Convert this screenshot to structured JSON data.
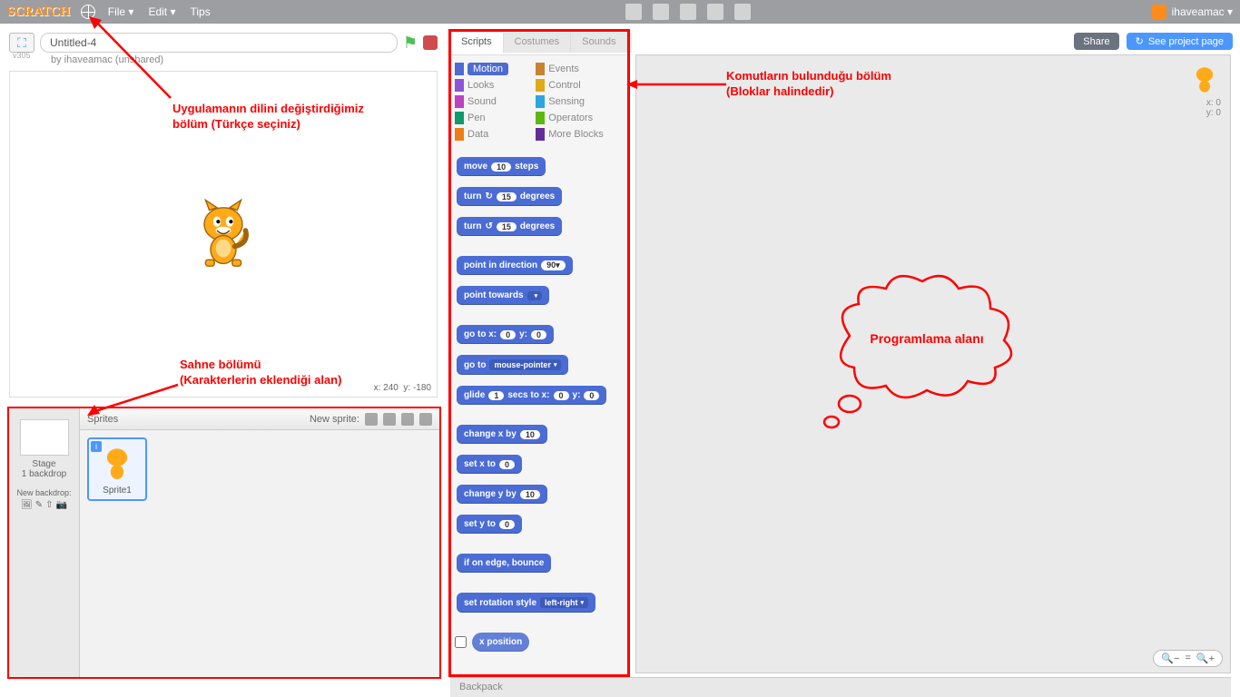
{
  "topbar": {
    "logo": "SCRATCH",
    "menu": {
      "file": "File ▾",
      "edit": "Edit ▾",
      "tips": "Tips"
    },
    "user": "ihaveamac ▾"
  },
  "topbtns": {
    "share": "Share",
    "seepage": "See project page"
  },
  "stagebar": {
    "title": "Untitled-4"
  },
  "byline": "by ihaveamac (unshared)",
  "version": "v305",
  "stage": {
    "xy_x": "x: 240",
    "xy_y": "y: -180"
  },
  "spritepanel": {
    "sprites": "Sprites",
    "newsprite": "New sprite:",
    "stage": "Stage",
    "backdrop": "1 backdrop",
    "newbackdrop": "New backdrop:",
    "sprite1": "Sprite1"
  },
  "tabs": {
    "scripts": "Scripts",
    "costumes": "Costumes",
    "sounds": "Sounds"
  },
  "categories": [
    {
      "name": "Motion",
      "color": "#4a6cd4",
      "active": true
    },
    {
      "name": "Events",
      "color": "#c88330"
    },
    {
      "name": "Looks",
      "color": "#8a55d7"
    },
    {
      "name": "Control",
      "color": "#e1a91a"
    },
    {
      "name": "Sound",
      "color": "#bb42c3"
    },
    {
      "name": "Sensing",
      "color": "#2ca5e2"
    },
    {
      "name": "Pen",
      "color": "#0e9a6c"
    },
    {
      "name": "Operators",
      "color": "#5cb712"
    },
    {
      "name": "Data",
      "color": "#ee7d16"
    },
    {
      "name": "More Blocks",
      "color": "#632d99"
    }
  ],
  "blocks": {
    "move": "move",
    "steps": "steps",
    "v10": "10",
    "turn": "turn",
    "degrees": "degrees",
    "v15": "15",
    "point_in_direction": "point in direction",
    "v90": "90▾",
    "point_towards": "point towards",
    "dd_blank": " ",
    "go_to_xy": "go to x:",
    "y": "y:",
    "v0": "0",
    "go_to": "go to",
    "mouse": "mouse-pointer",
    "glide": "glide",
    "secs": "secs to x:",
    "v1": "1",
    "change_x": "change x by",
    "set_x": "set x to",
    "change_y": "change y by",
    "set_y": "set y to",
    "if_edge": "if on edge, bounce",
    "set_rot": "set rotation style",
    "lr": "left-right",
    "xpos": "x position"
  },
  "scriptcorner": {
    "x": "x: 0",
    "y": "y: 0"
  },
  "backpack": "Backpack",
  "annotations": {
    "lang1": "Uygulamanın dilini değiştirdiğimiz",
    "lang2": "bölüm (Türkçe seçiniz)",
    "blocks1": "Komutların bulunduğu bölüm",
    "blocks2": "(Bloklar halindedir)",
    "stage1": "Sahne bölümü",
    "stage2": "(Karakterlerin eklendiği alan)",
    "prog": "Programlama alanı"
  }
}
